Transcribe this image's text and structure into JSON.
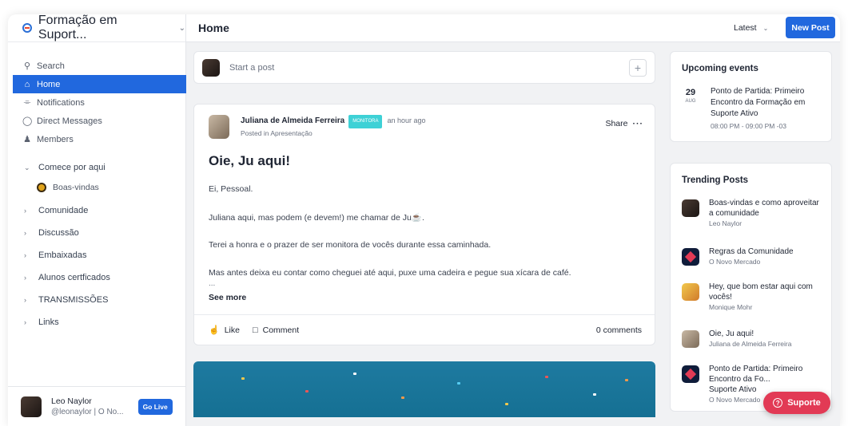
{
  "sidebar": {
    "community_name": "Formação em Suport...",
    "nav": [
      {
        "label": "Search",
        "icon": "search-icon"
      },
      {
        "label": "Home",
        "icon": "home-icon"
      },
      {
        "label": "Notifications",
        "icon": "bell-icon"
      },
      {
        "label": "Direct Messages",
        "icon": "chat-icon"
      },
      {
        "label": "Members",
        "icon": "members-icon"
      }
    ],
    "sections": [
      {
        "label": "Comece por aqui",
        "expanded": true,
        "items": [
          {
            "label": "Boas-vindas"
          }
        ]
      },
      {
        "label": "Comunidade"
      },
      {
        "label": "Discussão"
      },
      {
        "label": "Embaixadas"
      },
      {
        "label": "Alunos certficados"
      },
      {
        "label": "TRANSMISSÕES"
      },
      {
        "label": "Links"
      }
    ],
    "profile": {
      "name": "Leo Naylor",
      "handle": "@leonaylor | O No...",
      "go_live": "Go Live"
    }
  },
  "header": {
    "title": "Home",
    "sort": "Latest",
    "new_post": "New Post"
  },
  "composer": {
    "placeholder": "Start a post",
    "plus": "+"
  },
  "post": {
    "author": "Juliana de Almeida Ferreira",
    "badge": "MONITORA",
    "time": "an hour ago",
    "posted_in": "Posted in Apresentação",
    "share": "Share",
    "more": "···",
    "title": "Oie, Ju aqui!",
    "paragraphs": [
      "Ei, Pessoal.",
      "Juliana aqui, mas podem (e devem!) me chamar de Ju☕.",
      "Terei a honra e o prazer de ser monitora de vocês durante essa caminhada.",
      "Mas antes deixa eu contar como cheguei até aqui, puxe uma cadeira e pegue sua xícara de café."
    ],
    "ellipsis": "...",
    "see_more": "See more",
    "like": "Like",
    "comment": "Comment",
    "comments_count": "0 comments"
  },
  "events": {
    "title": "Upcoming events",
    "items": [
      {
        "day": "29",
        "month": "AUG",
        "title": "Ponto de Partida: Primeiro Encontro da Formação em Suporte Ativo",
        "time": "08:00 PM - 09:00 PM -03"
      }
    ]
  },
  "trending": {
    "title": "Trending Posts",
    "items": [
      {
        "title": "Boas-vindas e como aproveitar a comunidade",
        "author": "Leo Naylor"
      },
      {
        "title": "Regras da Comunidade",
        "author": "O Novo Mercado"
      },
      {
        "title": "Hey, que bom estar aqui com vocês!",
        "author": "Monique Mohr"
      },
      {
        "title": "Oie, Ju aqui!",
        "author": "Juliana de Almeida Ferreira"
      },
      {
        "title": "Ponto de Partida: Primeiro Encontro da Fo...",
        "title_line2": "Suporte Ativo",
        "author": "O Novo Mercado"
      }
    ]
  },
  "support": {
    "label": "Suporte",
    "icon": "?"
  },
  "colors": {
    "accent": "#2168de",
    "support": "#e23a55",
    "badge": "#3ed1d6"
  }
}
